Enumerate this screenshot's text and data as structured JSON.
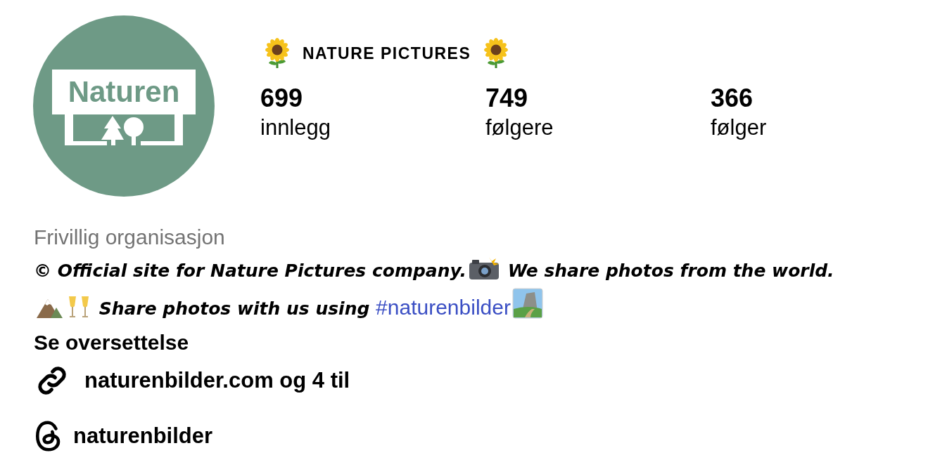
{
  "profile": {
    "avatar_logo": "Naturen",
    "title": "NATURE PICTURES",
    "stats": [
      {
        "value": "699",
        "label": "innlegg"
      },
      {
        "value": "749",
        "label": "følgere"
      },
      {
        "value": "366",
        "label": "følger"
      }
    ],
    "category": "Frivillig organisasjon",
    "bio": [
      {
        "kind": "text",
        "text": "© Official site for Nature Pictures company."
      },
      {
        "kind": "camera"
      },
      {
        "kind": "text",
        "text": " We share photos from the world."
      },
      {
        "kind": "mountain"
      },
      {
        "kind": "glasses"
      },
      {
        "kind": "text",
        "text": " Share photos with us using "
      },
      {
        "kind": "hashtag",
        "text": "#naturenbilder"
      },
      {
        "kind": "landscape"
      }
    ],
    "translate": "Se oversettelse",
    "link": "naturenbilder.com og 4 til",
    "threads": "naturenbilder"
  }
}
